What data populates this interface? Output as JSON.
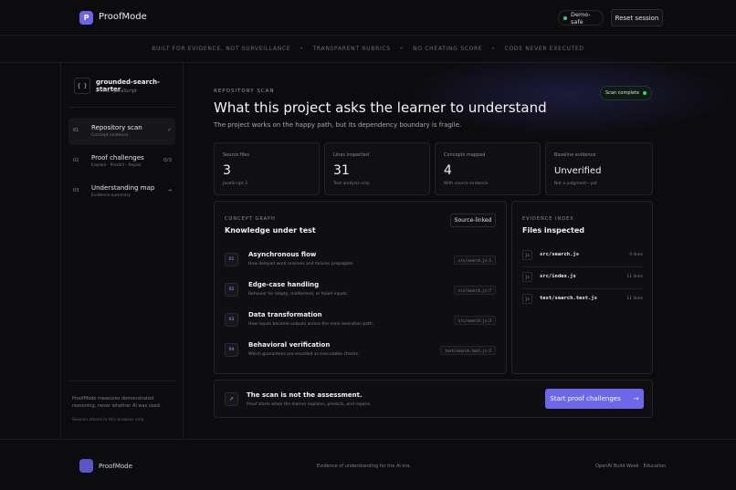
{
  "header": {
    "logo_letter": "P",
    "brand": "ProofMode",
    "status": "Demo-safe",
    "reset": "Reset session"
  },
  "strip": [
    "BUILT FOR EVIDENCE, NOT SURVEILLANCE",
    "TRANSPARENT RUBRICS",
    "NO CHEATING SCORE",
    "CODE NEVER EXECUTED"
  ],
  "strip_sep": "•",
  "sidebar": {
    "repo_icon": "{ }",
    "repo_name": "grounded-search-starter",
    "repo_meta": "3 files · JavaScript",
    "steps": [
      {
        "num": "01",
        "title": "Repository scan",
        "sub": "Concept evidence",
        "right": "✓"
      },
      {
        "num": "02",
        "title": "Proof challenges",
        "sub": "Explain · Predict · Repair",
        "right": "0/3"
      },
      {
        "num": "03",
        "title": "Understanding map",
        "sub": "Evidence summary",
        "right": "→"
      }
    ],
    "note": "ProofMode measures demonstrated reasoning, never whether AI was used.",
    "note2": "Session stored in this browser only."
  },
  "main": {
    "kicker": "REPOSITORY SCAN",
    "title": "What this project asks the learner to understand",
    "subtitle": "The project works on the happy path, but its dependency boundary is fragile.",
    "scan_badge": "Scan complete",
    "stats": [
      {
        "label": "Source files",
        "value": "3",
        "note": "JavaScript 3"
      },
      {
        "label": "Lines inspected",
        "value": "31",
        "note": "Text analysis only"
      },
      {
        "label": "Concepts mapped",
        "value": "4",
        "note": "With source evidence"
      },
      {
        "label": "Baseline evidence",
        "value": "Unverified",
        "note": "Not a judgment—yet"
      }
    ],
    "concept_graph": {
      "kicker": "CONCEPT GRAPH",
      "title": "Knowledge under test",
      "badge": "Source-linked",
      "items": [
        {
          "num": "01",
          "title": "Asynchronous flow",
          "desc": "How delayed work resolves and failures propagate.",
          "code": "src/search.js:1"
        },
        {
          "num": "02",
          "title": "Edge-case handling",
          "desc": "Behavior for empty, malformed, or failed inputs.",
          "code": "src/search.js:7"
        },
        {
          "num": "03",
          "title": "Data transformation",
          "desc": "How inputs become outputs across the main execution path.",
          "code": "src/search.js:3"
        },
        {
          "num": "04",
          "title": "Behavioral verification",
          "desc": "Which guarantees are encoded as executable checks.",
          "code": "test/search.test.js:2"
        }
      ]
    },
    "evidence_index": {
      "kicker": "EVIDENCE INDEX",
      "title": "Files inspected",
      "icon": "js",
      "files": [
        {
          "name": "src/search.js",
          "lines": "9 lines"
        },
        {
          "name": "src/index.js",
          "lines": "11 lines"
        },
        {
          "name": "test/search.test.js",
          "lines": "11 lines"
        }
      ]
    },
    "cta": {
      "icon": "↗",
      "title": "The scan is not the assessment.",
      "sub": "Proof starts when the learner explains, predicts, and repairs.",
      "button": "Start proof challenges",
      "arrow": "→"
    }
  },
  "footer": {
    "brand": "ProofMode",
    "middle": "Evidence of understanding for the AI era.",
    "right": "OpenAI Build Week · Education"
  },
  "colors": {
    "accent": "#6d67ea",
    "success": "#35d07f",
    "background": "#0c0c0f"
  }
}
